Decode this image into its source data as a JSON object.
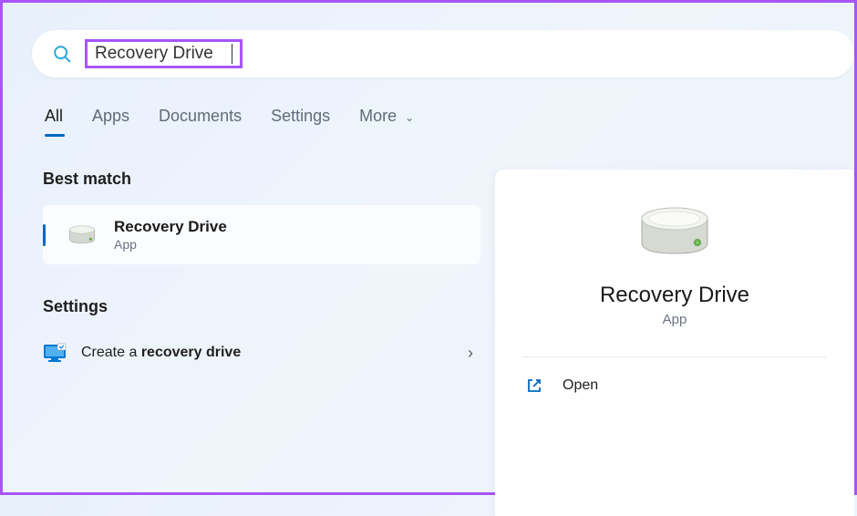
{
  "search": {
    "query": "Recovery Drive"
  },
  "tabs": {
    "all": "All",
    "apps": "Apps",
    "documents": "Documents",
    "settings": "Settings",
    "more": "More"
  },
  "sections": {
    "best_match": "Best match",
    "settings": "Settings"
  },
  "best_match_result": {
    "title": "Recovery Drive",
    "subtitle": "App"
  },
  "settings_result": {
    "prefix": "Create a ",
    "bold": "recovery drive"
  },
  "detail": {
    "title": "Recovery Drive",
    "subtitle": "App",
    "open": "Open"
  }
}
